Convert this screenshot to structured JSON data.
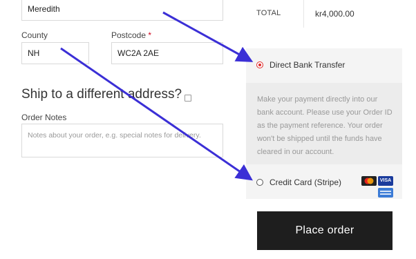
{
  "billing": {
    "name_value": "Meredith",
    "county_label": "County",
    "county_value": "NH",
    "postcode_label": "Postcode",
    "postcode_required": "*",
    "postcode_value": "WC2A 2AE"
  },
  "shipping": {
    "heading": "Ship to a different address?"
  },
  "order_notes": {
    "label": "Order Notes",
    "placeholder": "Notes about your order, e.g. special notes for delivery."
  },
  "order_summary": {
    "total_label": "TOTAL",
    "total_value": "kr4,000.00"
  },
  "payment": {
    "methods": [
      {
        "label": "Direct Bank Transfer",
        "selected": true
      },
      {
        "label": "Credit Card (Stripe)",
        "selected": false
      }
    ],
    "bank_description": "Make your payment directly into our bank account. Please use your Order ID as the payment reference. Your order won't be shipped until the funds have cleared in our account.",
    "card_icons": [
      "mastercard-icon",
      "visa-icon",
      "amex-icon"
    ],
    "visa_text": "VISA"
  },
  "place_order_label": "Place order",
  "colors": {
    "accent_radio": "#e02a2a",
    "annotation_arrow": "#3b2fd6",
    "button_bg": "#1e1e1e"
  }
}
